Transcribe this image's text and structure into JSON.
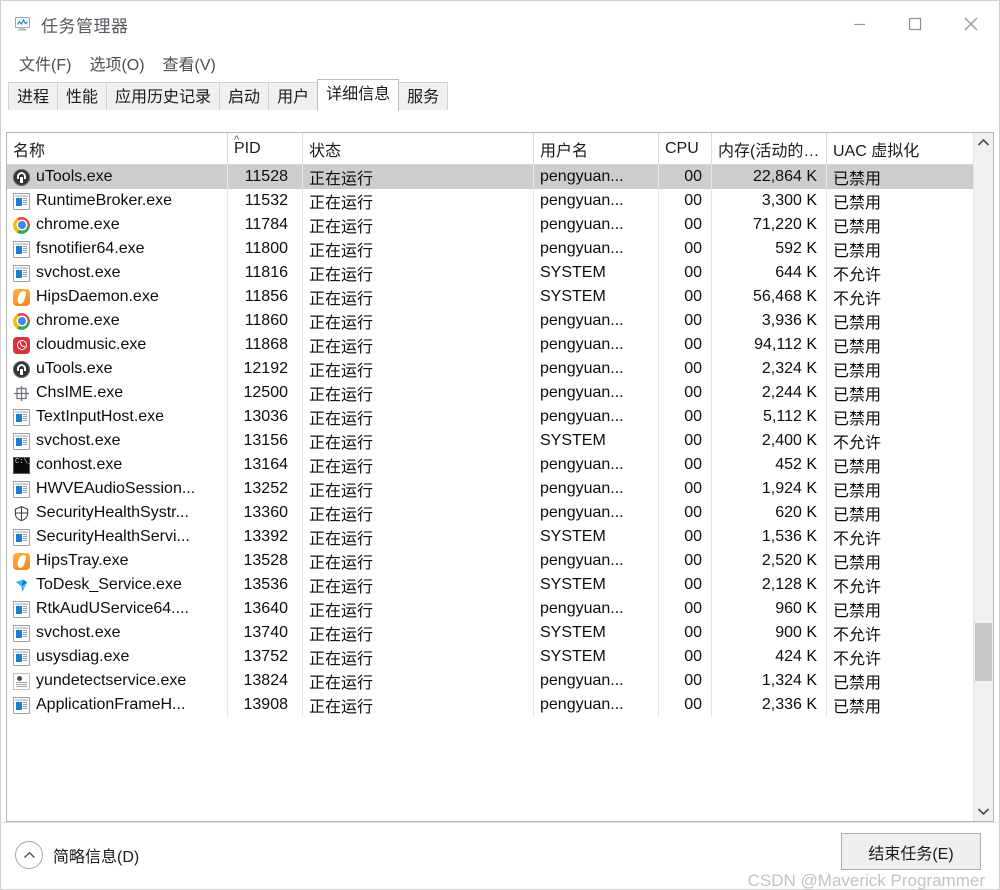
{
  "window": {
    "title": "任务管理器",
    "icon": "task-manager-icon",
    "controls": {
      "minimize": "—",
      "maximize": "□",
      "close": "✕"
    }
  },
  "menu": {
    "items": [
      {
        "label": "文件(F)"
      },
      {
        "label": "选项(O)"
      },
      {
        "label": "查看(V)"
      }
    ]
  },
  "tabs": {
    "items": [
      {
        "label": "进程",
        "active": false
      },
      {
        "label": "性能",
        "active": false
      },
      {
        "label": "应用历史记录",
        "active": false
      },
      {
        "label": "启动",
        "active": false
      },
      {
        "label": "用户",
        "active": false
      },
      {
        "label": "详细信息",
        "active": true
      },
      {
        "label": "服务",
        "active": false
      }
    ]
  },
  "table": {
    "columns": [
      {
        "key": "name",
        "label": "名称",
        "sort": ""
      },
      {
        "key": "pid",
        "label": "PID",
        "sort": "asc"
      },
      {
        "key": "state",
        "label": "状态",
        "sort": ""
      },
      {
        "key": "user",
        "label": "用户名",
        "sort": ""
      },
      {
        "key": "cpu",
        "label": "CPU",
        "sort": ""
      },
      {
        "key": "mem",
        "label": "内存(活动的…",
        "sort": ""
      },
      {
        "key": "uac",
        "label": "UAC 虚拟化",
        "sort": ""
      }
    ],
    "sort_caret": "^",
    "rows": [
      {
        "icon": "utools-icon",
        "name": "uTools.exe",
        "pid": "11528",
        "state": "正在运行",
        "user": "pengyuan...",
        "cpu": "00",
        "mem": "22,864 K",
        "uac": "已禁用",
        "selected": true
      },
      {
        "icon": "app-window-icon",
        "name": "RuntimeBroker.exe",
        "pid": "11532",
        "state": "正在运行",
        "user": "pengyuan...",
        "cpu": "00",
        "mem": "3,300 K",
        "uac": "已禁用",
        "selected": false
      },
      {
        "icon": "chrome-icon",
        "name": "chrome.exe",
        "pid": "11784",
        "state": "正在运行",
        "user": "pengyuan...",
        "cpu": "00",
        "mem": "71,220 K",
        "uac": "已禁用",
        "selected": false
      },
      {
        "icon": "app-window-icon",
        "name": "fsnotifier64.exe",
        "pid": "11800",
        "state": "正在运行",
        "user": "pengyuan...",
        "cpu": "00",
        "mem": "592 K",
        "uac": "已禁用",
        "selected": false
      },
      {
        "icon": "app-window-icon",
        "name": "svchost.exe",
        "pid": "11816",
        "state": "正在运行",
        "user": "SYSTEM",
        "cpu": "00",
        "mem": "644 K",
        "uac": "不允许",
        "selected": false
      },
      {
        "icon": "hips-flame-icon",
        "name": "HipsDaemon.exe",
        "pid": "11856",
        "state": "正在运行",
        "user": "SYSTEM",
        "cpu": "00",
        "mem": "56,468 K",
        "uac": "不允许",
        "selected": false
      },
      {
        "icon": "chrome-icon",
        "name": "chrome.exe",
        "pid": "11860",
        "state": "正在运行",
        "user": "pengyuan...",
        "cpu": "00",
        "mem": "3,936 K",
        "uac": "已禁用",
        "selected": false
      },
      {
        "icon": "cloudmusic-icon",
        "name": "cloudmusic.exe",
        "pid": "11868",
        "state": "正在运行",
        "user": "pengyuan...",
        "cpu": "00",
        "mem": "94,112 K",
        "uac": "已禁用",
        "selected": false
      },
      {
        "icon": "utools-icon",
        "name": "uTools.exe",
        "pid": "12192",
        "state": "正在运行",
        "user": "pengyuan...",
        "cpu": "00",
        "mem": "2,324 K",
        "uac": "已禁用",
        "selected": false
      },
      {
        "icon": "chsime-icon",
        "name": "ChsIME.exe",
        "pid": "12500",
        "state": "正在运行",
        "user": "pengyuan...",
        "cpu": "00",
        "mem": "2,244 K",
        "uac": "已禁用",
        "selected": false
      },
      {
        "icon": "app-window-icon",
        "name": "TextInputHost.exe",
        "pid": "13036",
        "state": "正在运行",
        "user": "pengyuan...",
        "cpu": "00",
        "mem": "5,112 K",
        "uac": "已禁用",
        "selected": false
      },
      {
        "icon": "app-window-icon",
        "name": "svchost.exe",
        "pid": "13156",
        "state": "正在运行",
        "user": "SYSTEM",
        "cpu": "00",
        "mem": "2,400 K",
        "uac": "不允许",
        "selected": false
      },
      {
        "icon": "console-icon",
        "name": "conhost.exe",
        "pid": "13164",
        "state": "正在运行",
        "user": "pengyuan...",
        "cpu": "00",
        "mem": "452 K",
        "uac": "已禁用",
        "selected": false
      },
      {
        "icon": "app-window-icon",
        "name": "HWVEAudioSession...",
        "pid": "13252",
        "state": "正在运行",
        "user": "pengyuan...",
        "cpu": "00",
        "mem": "1,924 K",
        "uac": "已禁用",
        "selected": false
      },
      {
        "icon": "shield-icon",
        "name": "SecurityHealthSystr...",
        "pid": "13360",
        "state": "正在运行",
        "user": "pengyuan...",
        "cpu": "00",
        "mem": "620 K",
        "uac": "已禁用",
        "selected": false
      },
      {
        "icon": "app-window-icon",
        "name": "SecurityHealthServi...",
        "pid": "13392",
        "state": "正在运行",
        "user": "SYSTEM",
        "cpu": "00",
        "mem": "1,536 K",
        "uac": "不允许",
        "selected": false
      },
      {
        "icon": "hips-flame-icon",
        "name": "HipsTray.exe",
        "pid": "13528",
        "state": "正在运行",
        "user": "pengyuan...",
        "cpu": "00",
        "mem": "2,520 K",
        "uac": "已禁用",
        "selected": false
      },
      {
        "icon": "todesk-icon",
        "name": "ToDesk_Service.exe",
        "pid": "13536",
        "state": "正在运行",
        "user": "SYSTEM",
        "cpu": "00",
        "mem": "2,128 K",
        "uac": "不允许",
        "selected": false
      },
      {
        "icon": "app-window-icon",
        "name": "RtkAudUService64....",
        "pid": "13640",
        "state": "正在运行",
        "user": "pengyuan...",
        "cpu": "00",
        "mem": "960 K",
        "uac": "已禁用",
        "selected": false
      },
      {
        "icon": "app-window-icon",
        "name": "svchost.exe",
        "pid": "13740",
        "state": "正在运行",
        "user": "SYSTEM",
        "cpu": "00",
        "mem": "900 K",
        "uac": "不允许",
        "selected": false
      },
      {
        "icon": "app-window-icon",
        "name": "usysdiag.exe",
        "pid": "13752",
        "state": "正在运行",
        "user": "SYSTEM",
        "cpu": "00",
        "mem": "424 K",
        "uac": "不允许",
        "selected": false
      },
      {
        "icon": "document-icon",
        "name": "yundetectservice.exe",
        "pid": "13824",
        "state": "正在运行",
        "user": "pengyuan...",
        "cpu": "00",
        "mem": "1,324 K",
        "uac": "已禁用",
        "selected": false
      },
      {
        "icon": "app-window-icon",
        "name": "ApplicationFrameH...",
        "pid": "13908",
        "state": "正在运行",
        "user": "pengyuan...",
        "cpu": "00",
        "mem": "2,336 K",
        "uac": "已禁用",
        "selected": false
      }
    ]
  },
  "scrollbar": {
    "up_arrow": "⌃",
    "down_arrow": "⌄"
  },
  "footer": {
    "fewer_details_label": "简略信息(D)",
    "end_task_label": "结束任务(E)",
    "watermark": "CSDN @Maverick Programmer"
  },
  "colors": {
    "selection": "#cdcdcd",
    "accent_blue": "#1b7fd4",
    "chrome_red": "#ea4335",
    "chrome_green": "#34a853",
    "chrome_yellow": "#fbbc05",
    "chrome_blue": "#4285f4",
    "hips_orange": "#f5851f",
    "cloudmusic_red": "#d8323a",
    "watermark_gray": "#c3c3c3"
  }
}
